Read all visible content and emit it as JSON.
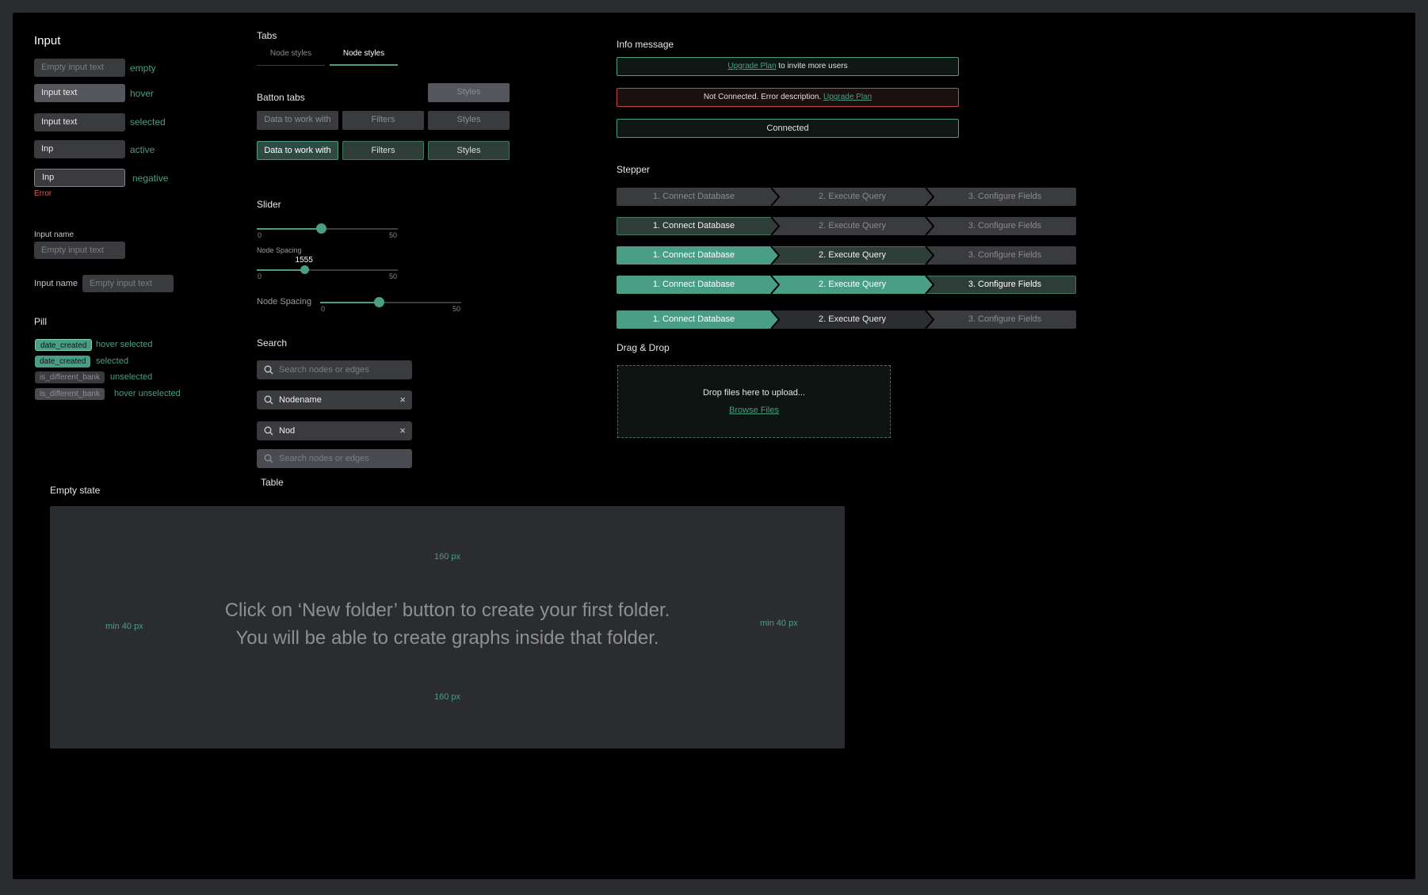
{
  "colors": {
    "accent": "#4a9e86",
    "error": "#e05b5b",
    "surface": "#2b2c30",
    "field": "#3a3b3f"
  },
  "input": {
    "title": "Input",
    "states": [
      {
        "value": "Empty input text",
        "note": "empty"
      },
      {
        "value": "Input text",
        "note": "hover"
      },
      {
        "value": "Input text",
        "note": "selected"
      },
      {
        "value": "Inp",
        "note": "active"
      },
      {
        "value": "Inp",
        "note": "negative"
      }
    ],
    "error_text": "Error",
    "labeled_top": {
      "label": "Input name",
      "placeholder": "Empty input text"
    },
    "labeled_left": {
      "label": "Input name",
      "placeholder": "Empty input text"
    }
  },
  "pill": {
    "title": "Pill",
    "items": [
      {
        "label": "date_created",
        "note": "hover selected"
      },
      {
        "label": "date_created",
        "note": "selected"
      },
      {
        "label": "is_different_bank",
        "note": "unselected"
      },
      {
        "label": "is_different_bank",
        "note": "hover unselected"
      }
    ]
  },
  "tabs": {
    "title": "Tabs",
    "items": [
      "Node styles",
      "Node styles"
    ]
  },
  "button_tabs": {
    "title": "Batton tabs",
    "hover_label": "Styles",
    "row1": [
      "Data to work with",
      "Filters",
      "Styles"
    ],
    "row2": [
      "Data to work with",
      "Filters",
      "Styles"
    ]
  },
  "slider": {
    "title": "Slider",
    "s1": {
      "min": "0",
      "max": "50",
      "value": 23
    },
    "s2": {
      "label": "Node Spacing",
      "value_label": "1555",
      "min": "0",
      "max": "50",
      "value": 17
    },
    "s3": {
      "label": "Node Spacing",
      "min": "0",
      "max": "50",
      "value": 21
    }
  },
  "search": {
    "title": "Search",
    "boxes": [
      {
        "text": "Search nodes or edges",
        "placeholder": true
      },
      {
        "text": "Nodename",
        "placeholder": false
      },
      {
        "text": "Nod",
        "placeholder": false
      },
      {
        "text": "Search nodes or edges",
        "placeholder": true
      }
    ],
    "clear_glyph": "×"
  },
  "table": {
    "title": "Table"
  },
  "info": {
    "title": "Info message",
    "m1": {
      "link": "Upgrade Plan",
      "text": " to invite more users"
    },
    "m2": {
      "text": "Not Connected. Error description. ",
      "link": "Upgrade Plan"
    },
    "m3": {
      "text": "Connected"
    }
  },
  "stepper": {
    "title": "Stepper",
    "steps": [
      "1. Connect Database",
      "2. Execute Query",
      "3. Configure Fields"
    ]
  },
  "dragdrop": {
    "title": "Drag & Drop",
    "text": "Drop files here to upload...",
    "link": "Browse Files"
  },
  "empty_state": {
    "title": "Empty state",
    "line1": "Click on ‘New folder’ button to create your first folder.",
    "line2": "You will be able to create graphs inside that folder.",
    "top": "160 px",
    "bottom": "160 px",
    "left": "min 40 px",
    "right": "min 40 px"
  }
}
